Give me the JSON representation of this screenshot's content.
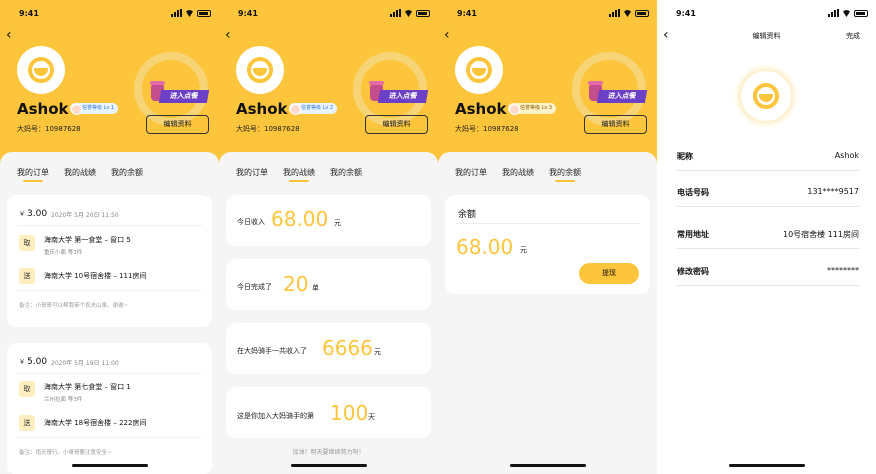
{
  "status": {
    "time": "9:41"
  },
  "profile": {
    "name": "Ashok",
    "uid": "大妈号：10987628",
    "edit_label": "编辑资料",
    "enter_label": "进入点餐",
    "badge1": "信誉等级 Lv 1",
    "badge2": "信誉等级 Lv 2",
    "badge3": "信誉等级 Lv 3"
  },
  "tabs": [
    "我的订单",
    "我的战绩",
    "我的余额"
  ],
  "orders": [
    {
      "currency": "￥",
      "price": "3.00",
      "date": "2020年 5月 20日 11:50",
      "pickup_tag": "取",
      "pickup": "海南大学 第一食堂 – 窗口 5",
      "pickup_sub": "重庆小面 等3件",
      "deliver_tag": "送",
      "deliver": "海南大学 10号宿舍楼 – 111房间",
      "note": "备注：小哥哥可以帮我带个农夫山泉。谢谢~"
    },
    {
      "currency": "￥",
      "price": "5.00",
      "date": "2020年 5月 19日 11:00",
      "pickup_tag": "取",
      "pickup": "海南大学 第七食堂 – 窗口 1",
      "pickup_sub": "兰州拉面 等3件",
      "deliver_tag": "送",
      "deliver": "海南大学 18号宿舍楼 – 222房间",
      "note": "备注：雨天慢行。小哥哥要注意安全~"
    }
  ],
  "stats": [
    {
      "label": "今日收入",
      "value": "68.00",
      "unit": "元"
    },
    {
      "label": "今日完成了",
      "value": "20",
      "unit": "单"
    },
    {
      "label": "在大妈骑手一共收入了",
      "value": "6666",
      "unit": "元"
    },
    {
      "label": "这是你加入大妈骑手的第",
      "value": "100",
      "unit": "天"
    }
  ],
  "stats_footer": "加油！明天要继续努力呀！",
  "balance": {
    "title": "余额",
    "value": "68.00",
    "unit": "元",
    "withdraw_label": "提现"
  },
  "edit": {
    "title": "编辑资料",
    "done_label": "完成",
    "fields": [
      {
        "key": "昵称",
        "value": "Ashok"
      },
      {
        "key": "电话号码",
        "value": "131****9517"
      },
      {
        "key": "常用地址",
        "value": "10号宿舍楼 111房间"
      },
      {
        "key": "修改密码",
        "value": "********"
      }
    ]
  },
  "colors": {
    "accent": "#fcc53b",
    "background": "#f5f5f5",
    "purple_tag": "#6b3fc6"
  }
}
